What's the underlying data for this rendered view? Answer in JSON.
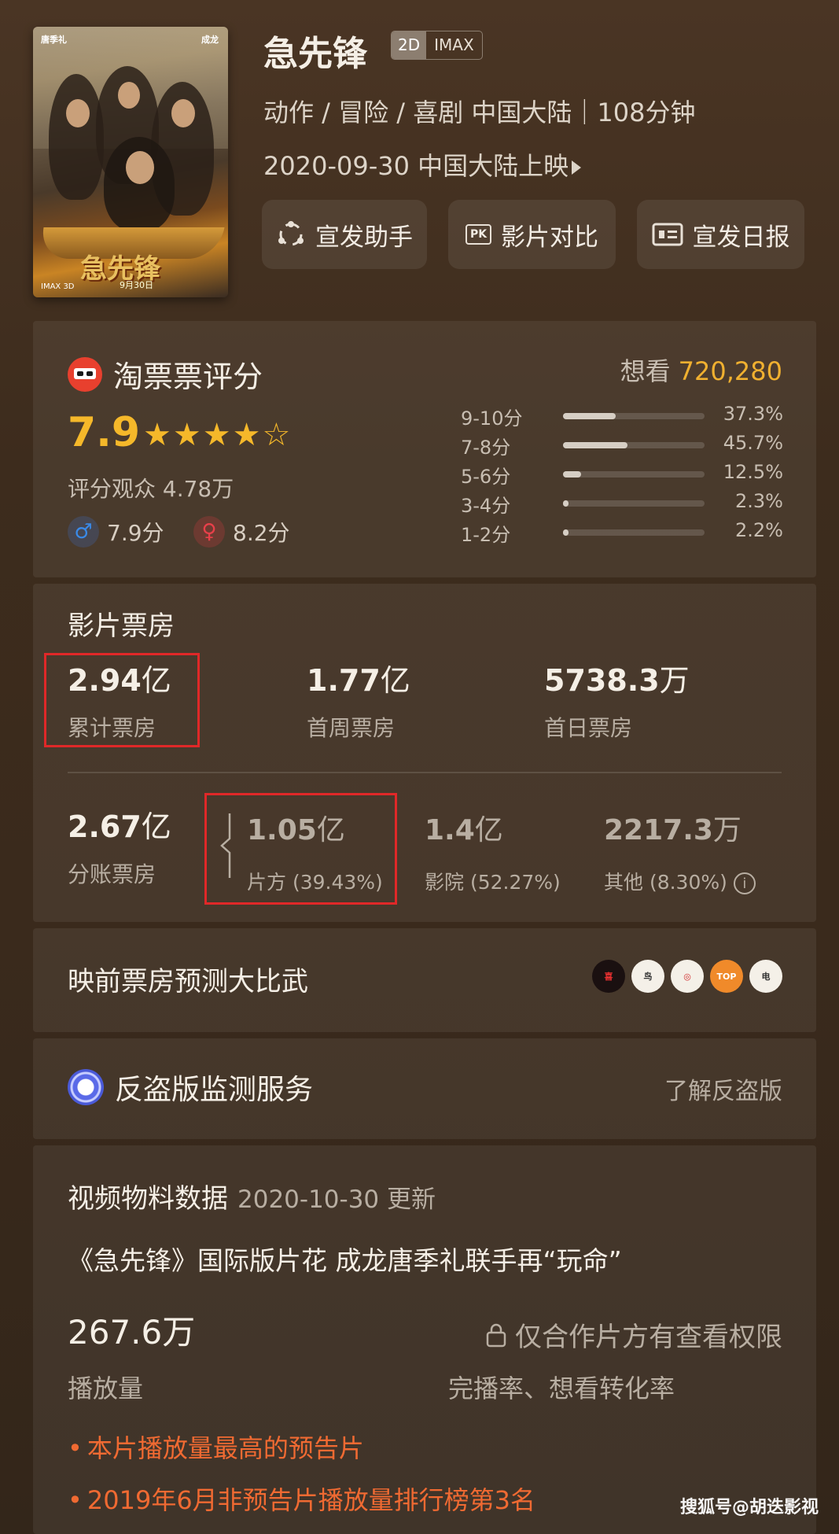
{
  "movie": {
    "poster_cast_left": "唐季礼",
    "poster_cast_right": "成龙",
    "poster_title": "急先锋",
    "poster_date": "9月30日",
    "poster_format": "IMAX 3D",
    "title": "急先锋",
    "format_2d": "2D",
    "format_imax": "IMAX",
    "genres_region_runtime": "动作 / 冒险 / 喜剧 中国大陆｜108分钟",
    "release": "2020-09-30 中国大陆上映"
  },
  "actions": [
    {
      "label": "宣发助手",
      "icon": "share-icon"
    },
    {
      "label": "影片对比",
      "icon": "pk-icon"
    },
    {
      "label": "宣发日报",
      "icon": "report-icon"
    }
  ],
  "rating": {
    "title": "淘票票评分",
    "want_label": "想看",
    "want_count": "720,280",
    "score": "7.9",
    "stars": "★★★★☆",
    "star_value": 4,
    "raters": "评分观众 4.78万",
    "male_score": "7.9分",
    "female_score": "8.2分",
    "male_icon": "♂",
    "female_icon": "♀",
    "distribution": [
      {
        "label": "9-10分",
        "pct": "37.3%",
        "value": 37.3
      },
      {
        "label": "7-8分",
        "pct": "45.7%",
        "value": 45.7
      },
      {
        "label": "5-6分",
        "pct": "12.5%",
        "value": 12.5
      },
      {
        "label": "3-4分",
        "pct": "2.3%",
        "value": 2.3
      },
      {
        "label": "1-2分",
        "pct": "2.2%",
        "value": 2.2
      }
    ]
  },
  "box_office": {
    "title": "影片票房",
    "total_value": "2.94",
    "total_unit": "亿",
    "total_label": "累计票房",
    "week_value": "1.77",
    "week_unit": "亿",
    "week_label": "首周票房",
    "day_value": "5738.3",
    "day_unit": "万",
    "day_label": "首日票房",
    "split_value": "2.67",
    "split_unit": "亿",
    "split_label": "分账票房",
    "producer_value": "1.05",
    "producer_unit": "亿",
    "producer_label": "片方 (39.43%)",
    "cinema_value": "1.4",
    "cinema_unit": "亿",
    "cinema_label": "影院 (52.27%)",
    "other_value": "2217.3",
    "other_unit": "万",
    "other_label": "其他 (8.30%)",
    "info_icon": "i"
  },
  "prediction": {
    "title": "映前票房预测大比武",
    "logos": [
      {
        "name": "logo-1",
        "color": "#1a1010",
        "text": "喜"
      },
      {
        "name": "logo-2",
        "color": "#f4f0e8",
        "text": "鸟"
      },
      {
        "name": "logo-3",
        "color": "#f4f0e8",
        "text": "◎"
      },
      {
        "name": "logo-4",
        "color": "#f08a2a",
        "text": "TOP"
      },
      {
        "name": "logo-5",
        "color": "#f4f0e8",
        "text": "电"
      }
    ]
  },
  "anti_piracy": {
    "title": "反盗版监测服务",
    "link": "了解反盗版"
  },
  "video": {
    "title": "视频物料数据",
    "updated": "2020-10-30 更新",
    "name": "《急先锋》国际版片花 成龙唐季礼联手再“玩命”",
    "plays_value": "267.6",
    "plays_unit": "万",
    "plays_label": "播放量",
    "locked_text": "仅合作片方有查看权限",
    "locked_sub": "完播率、想看转化率",
    "bullets": [
      "本片播放量最高的预告片",
      "2019年6月非预告片播放量排行榜第3名"
    ]
  },
  "watermark": "搜狐号@胡迭影视"
}
